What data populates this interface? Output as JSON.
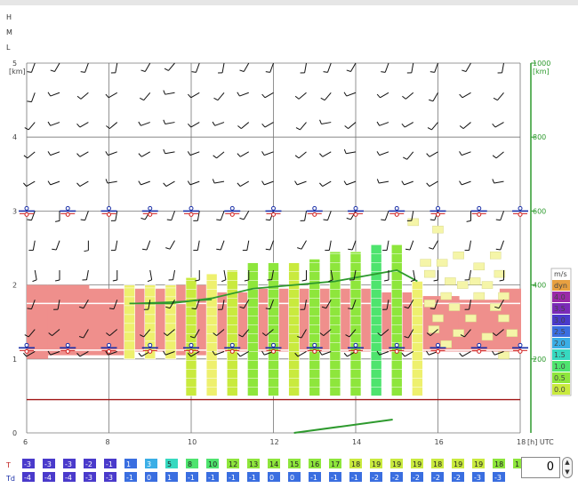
{
  "colors": {
    "ws_levels": [
      "#f5f5a8",
      "#eef06e",
      "#c9ea3e",
      "#8ee63c",
      "#4ee46e",
      "#36d9c0",
      "#3aaee6",
      "#3a6ee0",
      "#4a3acb",
      "#7a2ab8",
      "#9a2aa8",
      "#e8a040"
    ]
  },
  "left_letters": [
    "H",
    "M",
    "L"
  ],
  "chart_data": {
    "type": "heatmap",
    "x_unit_label": "[h] UTC",
    "x_ticks": [
      "6",
      "8",
      "10",
      "12",
      "14",
      "16",
      "18"
    ],
    "y_left_unit": "[km]",
    "y_left_ticks": [
      "0",
      "1",
      "2",
      "3",
      "4",
      "5"
    ],
    "y_right_unit": "[km]",
    "y_right_ticks": [
      "200",
      "400",
      "600",
      "800",
      "1000"
    ],
    "legend_title": "m/s",
    "legend_items": [
      "dyn",
      "4.0",
      "3.5",
      "3.0",
      "2.5",
      "2.0",
      "1.5",
      "1.0",
      "0.5",
      "0.0"
    ],
    "hours": [
      6,
      7,
      8,
      9,
      10,
      11,
      12,
      13,
      14,
      15,
      16,
      17,
      18
    ],
    "red_layer_km": [
      [
        1.0,
        2.0
      ],
      [
        1.05,
        2.0
      ],
      [
        1.05,
        1.95
      ],
      [
        1.1,
        1.95
      ],
      [
        1.05,
        2.0
      ],
      [
        1.1,
        1.9
      ],
      [
        1.1,
        1.95
      ],
      [
        1.1,
        1.95
      ],
      [
        1.1,
        1.95
      ],
      [
        1.1,
        1.9
      ],
      [
        1.1,
        1.85
      ],
      [
        1.1,
        1.8
      ],
      [
        1.1,
        1.95
      ]
    ],
    "columns": [
      {
        "hour": 8.5,
        "top": 2.0,
        "base": 1.0,
        "level": 1
      },
      {
        "hour": 9.0,
        "top": 2.0,
        "base": 1.0,
        "level": 1
      },
      {
        "hour": 9.5,
        "top": 2.0,
        "base": 1.0,
        "level": 1
      },
      {
        "hour": 10.0,
        "top": 2.1,
        "base": 0.5,
        "level": 2
      },
      {
        "hour": 10.5,
        "top": 2.15,
        "base": 0.5,
        "level": 1
      },
      {
        "hour": 11.0,
        "top": 2.2,
        "base": 0.5,
        "level": 2
      },
      {
        "hour": 11.5,
        "top": 2.3,
        "base": 0.5,
        "level": 3
      },
      {
        "hour": 12.0,
        "top": 2.3,
        "base": 0.5,
        "level": 3
      },
      {
        "hour": 12.5,
        "top": 2.3,
        "base": 0.5,
        "level": 2
      },
      {
        "hour": 13.0,
        "top": 2.35,
        "base": 0.5,
        "level": 3
      },
      {
        "hour": 13.5,
        "top": 2.45,
        "base": 0.5,
        "level": 3
      },
      {
        "hour": 14.0,
        "top": 2.45,
        "base": 0.5,
        "level": 3
      },
      {
        "hour": 14.5,
        "top": 2.55,
        "base": 0.5,
        "level": 4
      },
      {
        "hour": 15.0,
        "top": 2.55,
        "base": 0.5,
        "level": 3
      },
      {
        "hour": 15.5,
        "top": 2.05,
        "base": 0.5,
        "level": 1
      }
    ],
    "upper_cloud_cells": [
      [
        15.7,
        2.3
      ],
      [
        16.1,
        2.3
      ],
      [
        16.5,
        2.4
      ],
      [
        17.0,
        2.25
      ],
      [
        17.4,
        2.4
      ],
      [
        17.5,
        2.15
      ],
      [
        16.9,
        2.05
      ],
      [
        16.3,
        2.05
      ],
      [
        15.8,
        2.15
      ],
      [
        16.6,
        2.0
      ],
      [
        17.2,
        2.0
      ],
      [
        16.2,
        1.85
      ],
      [
        17.0,
        1.85
      ],
      [
        17.6,
        1.85
      ],
      [
        15.8,
        1.75
      ],
      [
        16.4,
        1.7
      ],
      [
        17.4,
        1.7
      ],
      [
        16.0,
        1.55
      ],
      [
        16.8,
        1.55
      ],
      [
        17.6,
        1.55
      ],
      [
        15.9,
        1.4
      ],
      [
        16.5,
        1.35
      ],
      [
        17.2,
        1.3
      ],
      [
        17.8,
        1.35
      ],
      [
        16.2,
        1.2
      ],
      [
        17.6,
        1.05
      ],
      [
        15.4,
        2.85
      ],
      [
        16.0,
        2.75
      ]
    ],
    "bl_height_km": [
      [
        8.5,
        1.75
      ],
      [
        9.5,
        1.75
      ],
      [
        10.5,
        1.82
      ],
      [
        11.5,
        1.95
      ],
      [
        12.5,
        2.0
      ],
      [
        13.5,
        2.05
      ],
      [
        14.5,
        2.15
      ],
      [
        15.0,
        2.2
      ],
      [
        15.5,
        2.05
      ]
    ],
    "bl_height2_km": [
      [
        8.5,
        1.75
      ],
      [
        9.5,
        1.77
      ],
      [
        10.5,
        1.8
      ]
    ],
    "ground_line_km": 0.45,
    "trace_km": [
      [
        12.5,
        0.0
      ],
      [
        14.9,
        0.18
      ]
    ],
    "lcl_levels_km": [
      3.0,
      1.15
    ],
    "temps": {
      "label": "T",
      "values": [
        "-3",
        "-3",
        "-3",
        "-2",
        "-1",
        "1",
        "3",
        "5",
        "8",
        "10",
        "12",
        "13",
        "14",
        "15",
        "16",
        "17",
        "18",
        "19",
        "19",
        "19",
        "18",
        "19",
        "19",
        "18",
        "1"
      ],
      "levels": [
        8,
        8,
        8,
        8,
        8,
        7,
        6,
        5,
        4,
        4,
        3,
        3,
        3,
        3,
        3,
        3,
        2,
        2,
        2,
        2,
        2,
        2,
        2,
        3,
        3
      ]
    },
    "dewpoints": {
      "label": "Td",
      "values": [
        "-4",
        "-4",
        "-4",
        "-3",
        "-3",
        "-1",
        "0",
        "1",
        "-1",
        "-1",
        "-1",
        "-1",
        "0",
        "0",
        "-1",
        "-1",
        "-1",
        "-2",
        "-2",
        "-2",
        "-2",
        "-2",
        "-3",
        "-3"
      ],
      "levels": [
        8,
        8,
        8,
        8,
        8,
        7,
        7,
        7,
        7,
        7,
        7,
        7,
        7,
        7,
        7,
        7,
        7,
        7,
        7,
        7,
        7,
        7,
        7,
        7
      ]
    },
    "wind_rows_km": [
      5.0,
      4.6,
      4.2,
      3.8,
      3.4,
      3.0,
      2.6,
      2.2,
      1.8,
      1.4,
      1.1
    ],
    "wind_cols_hour": [
      6.2,
      6.8,
      7.5,
      8.2,
      9.0,
      9.6,
      10.2,
      10.8,
      11.4,
      12.0,
      12.8,
      13.4,
      14.0,
      14.8,
      15.4,
      16.0,
      16.8,
      17.6
    ],
    "wind_dir_deg": [
      [
        200,
        210,
        200,
        190,
        210,
        220,
        200,
        190,
        210,
        200,
        190,
        200,
        210,
        200,
        190,
        200,
        210,
        190
      ],
      [
        200,
        250,
        230,
        240,
        220,
        260,
        240,
        220,
        250,
        240,
        230,
        220,
        250,
        240,
        230,
        210,
        240,
        220
      ],
      [
        220,
        250,
        240,
        230,
        250,
        260,
        240,
        250,
        230,
        240,
        220,
        260,
        230,
        250,
        240,
        220,
        230,
        240
      ],
      [
        230,
        250,
        240,
        250,
        240,
        260,
        250,
        230,
        240,
        250,
        230,
        240,
        260,
        250,
        220,
        240,
        250,
        230
      ],
      [
        240,
        250,
        240,
        260,
        250,
        240,
        250,
        260,
        240,
        250,
        250,
        240,
        250,
        260,
        250,
        240,
        250,
        260
      ],
      [
        200,
        180,
        200,
        190,
        210,
        200,
        190,
        200,
        210,
        200,
        190,
        200,
        210,
        200,
        190,
        200,
        180,
        200
      ],
      [
        190,
        200,
        180,
        190,
        200,
        210,
        190,
        200,
        190,
        200,
        210,
        190,
        200,
        190,
        200,
        210,
        190,
        200
      ],
      [
        170,
        180,
        190,
        180,
        170,
        190,
        180,
        170,
        180,
        190,
        180,
        170,
        190,
        180,
        170,
        180,
        190,
        180
      ],
      [
        200,
        190,
        210,
        200,
        190,
        210,
        200,
        190,
        210,
        200,
        190,
        210,
        200,
        190,
        210,
        200,
        190,
        210
      ],
      [
        220,
        230,
        210,
        230,
        220,
        230,
        210,
        230,
        220,
        230,
        210,
        230,
        220,
        230,
        210,
        230,
        220,
        230
      ],
      [
        240,
        250,
        240,
        250,
        240,
        250,
        240,
        250,
        240,
        250,
        240,
        250,
        240,
        250,
        240,
        250,
        240,
        250
      ]
    ]
  },
  "stepper": {
    "value": "0"
  }
}
